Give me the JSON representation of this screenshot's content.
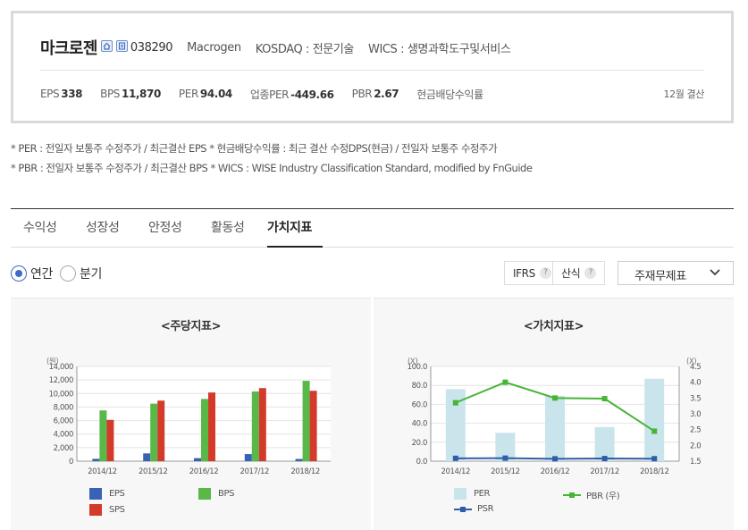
{
  "company": {
    "name": "마크로젠",
    "code": "038290",
    "english_name": "Macrogen",
    "market": "KOSDAQ : 전문기술",
    "wics": "WICS : 생명과학도구및서비스",
    "icons": [
      "home-icon",
      "report-icon"
    ]
  },
  "metrics": [
    {
      "label": "EPS",
      "value": "338"
    },
    {
      "label": "BPS",
      "value": "11,870"
    },
    {
      "label": "PER",
      "value": "94.04"
    },
    {
      "label": "업종PER",
      "value": "-449.66"
    },
    {
      "label": "PBR",
      "value": "2.67"
    },
    {
      "label": "현금배당수익률",
      "value": ""
    }
  ],
  "settlement": "12월 결산",
  "notes": [
    "* PER : 전일자 보통주 수정주가 / 최근결산 EPS * 현금배당수익률 : 최근 결산 수정DPS(현금) / 전일자 보통주 수정주가",
    "* PBR : 전일자 보통주 수정주가 / 최근결산 BPS * WICS : WISE Industry Classification Standard, modified by FnGuide"
  ],
  "tabs": [
    {
      "label": "수익성",
      "active": false
    },
    {
      "label": "성장성",
      "active": false
    },
    {
      "label": "안정성",
      "active": false
    },
    {
      "label": "활동성",
      "active": false
    },
    {
      "label": "가치지표",
      "active": true
    }
  ],
  "period": {
    "annual": "연간",
    "quarter": "분기",
    "selected": "annual"
  },
  "buttons": {
    "ifrs": "IFRS",
    "formula": "산식",
    "help_glyph": "?"
  },
  "dropdown": {
    "selected": "주재무제표"
  },
  "colors": {
    "eps": "#3a62b4",
    "bps": "#58b848",
    "sps": "#d33a2a",
    "per": "#c9e4ea",
    "pbr": "#46b535",
    "psr": "#2e5ea8"
  },
  "chart_data": [
    {
      "type": "bar",
      "title": "<주당지표>",
      "yunit": "(원)",
      "categories": [
        "2014/12",
        "2015/12",
        "2016/12",
        "2017/12",
        "2018/12"
      ],
      "series": [
        {
          "name": "EPS",
          "values": [
            350,
            1150,
            450,
            1050,
            330
          ]
        },
        {
          "name": "BPS",
          "values": [
            7500,
            8500,
            9200,
            10300,
            11870
          ]
        },
        {
          "name": "SPS",
          "values": [
            6100,
            8950,
            10150,
            10800,
            10400
          ]
        }
      ],
      "ylim": [
        0,
        14000
      ],
      "yticks": [
        "0",
        "2,000",
        "4,000",
        "6,000",
        "8,000",
        "10,000",
        "12,000",
        "14,000"
      ],
      "grid": true,
      "legend": "bottom"
    },
    {
      "type": "bar+line",
      "title": "<가치지표>",
      "left_unit": "(X)",
      "right_unit": "(X)",
      "categories": [
        "2014/12",
        "2015/12",
        "2016/12",
        "2017/12",
        "2018/12"
      ],
      "series": [
        {
          "name": "PER",
          "type": "bar",
          "axis": "left",
          "values": [
            76.0,
            30.0,
            69.0,
            36.0,
            87.0
          ]
        },
        {
          "name": "PBR (우)",
          "type": "line",
          "axis": "right",
          "values": [
            3.35,
            4.0,
            3.5,
            3.48,
            2.45
          ]
        },
        {
          "name": "PSR",
          "type": "line",
          "axis": "left",
          "values": [
            3.0,
            3.2,
            2.5,
            2.8,
            2.6
          ]
        }
      ],
      "ylim_left": [
        0,
        100
      ],
      "ylim_right": [
        1.5,
        4.5
      ],
      "yticks_left": [
        "0.0",
        "20.0",
        "40.0",
        "60.0",
        "80.0",
        "100.0"
      ],
      "yticks_right": [
        "1.5",
        "2.0",
        "2.5",
        "3.0",
        "3.5",
        "4.0",
        "4.5"
      ],
      "grid": true,
      "legend": "bottom"
    }
  ]
}
